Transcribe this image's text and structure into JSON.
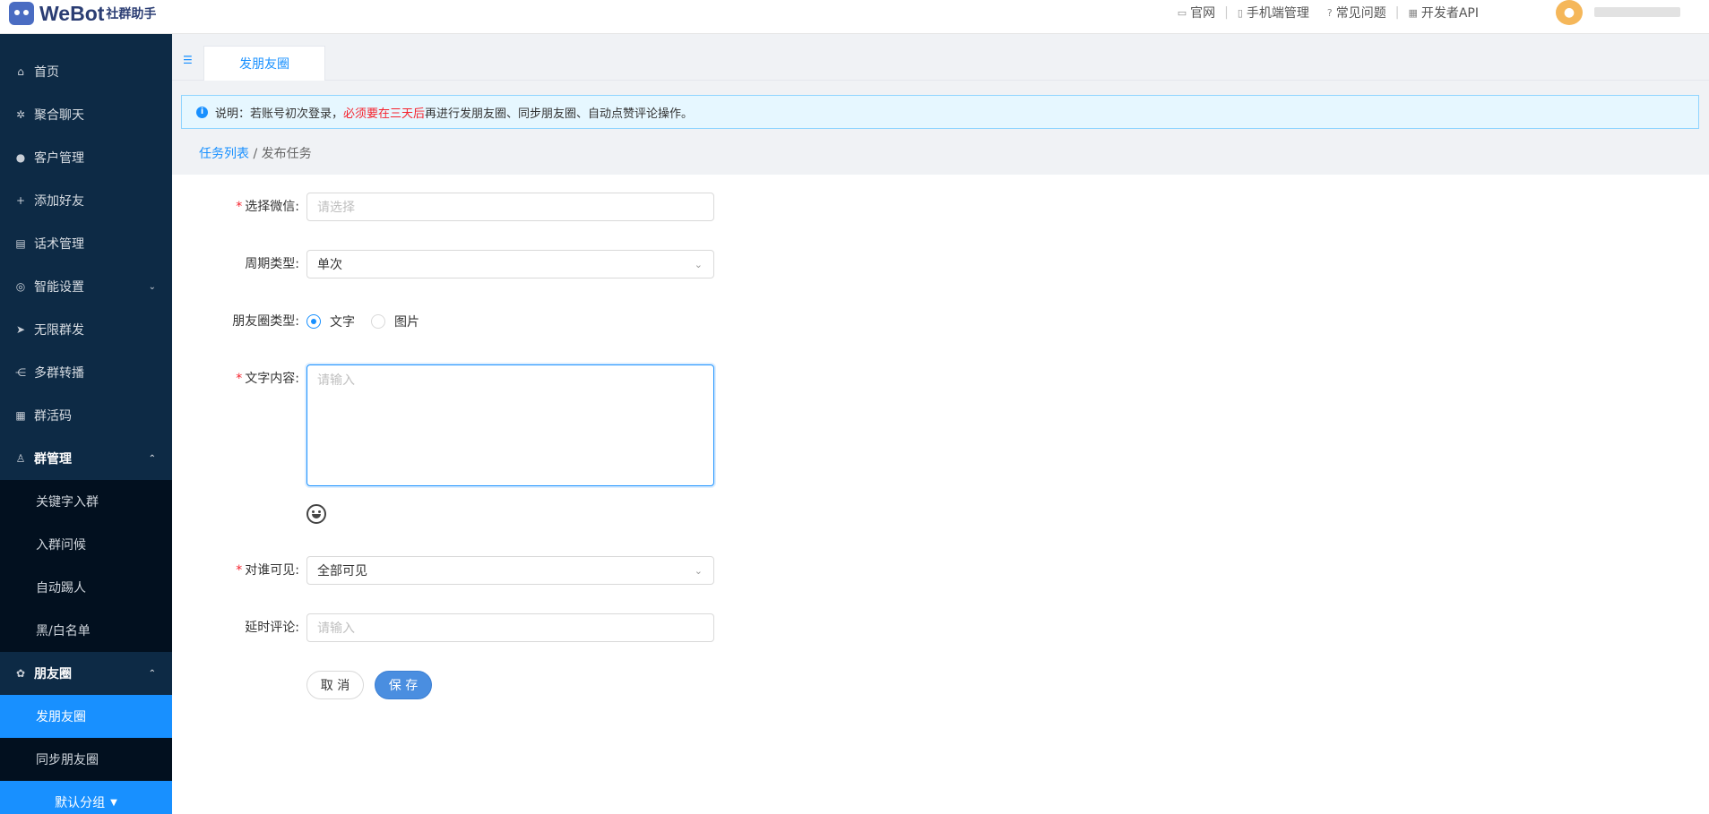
{
  "brand": {
    "name": "WeBot",
    "subtitle": "社群助手"
  },
  "top_nav": [
    {
      "icon": "monitor-icon",
      "label": "官网"
    },
    {
      "icon": "phone-icon",
      "label": "手机端管理"
    },
    {
      "icon": "question-icon",
      "label": "常见问题"
    },
    {
      "icon": "api-icon",
      "label": "开发者API"
    }
  ],
  "sidebar": {
    "items": [
      {
        "icon": "home-icon",
        "label": "首页"
      },
      {
        "icon": "gear-icon",
        "label": "聚合聊天"
      },
      {
        "icon": "user-icon",
        "label": "客户管理"
      },
      {
        "icon": "add-user-icon",
        "label": "添加好友"
      },
      {
        "icon": "document-icon",
        "label": "话术管理"
      },
      {
        "icon": "smart-settings-icon",
        "label": "智能设置"
      },
      {
        "icon": "send-icon",
        "label": "无限群发"
      },
      {
        "icon": "relay-icon",
        "label": "多群转播"
      },
      {
        "icon": "qrcode-icon",
        "label": "群活码"
      },
      {
        "icon": "group-icon",
        "label": "群管理"
      }
    ],
    "group_sub": [
      "关键字入群",
      "入群问候",
      "自动踢人",
      "黑/白名单"
    ],
    "moments": {
      "icon": "moments-icon",
      "label": "朋友圈"
    },
    "moments_sub": [
      "发朋友圈",
      "同步朋友圈"
    ],
    "default_group": "默认分组"
  },
  "tab": {
    "label": "发朋友圈"
  },
  "notice": {
    "prefix": "说明：若账号初次登录，",
    "highlight": "必须要在三天后",
    "suffix": "再进行发朋友圈、同步朋友圈、自动点赞评论操作。"
  },
  "breadcrumb": {
    "parent": "任务列表",
    "separator": " / ",
    "current": "发布任务"
  },
  "form": {
    "wechat_label": "选择微信:",
    "wechat_placeholder": "请选择",
    "cycle_label": "周期类型:",
    "cycle_value": "单次",
    "type_label": "朋友圈类型:",
    "type_options": [
      "文字",
      "图片"
    ],
    "content_label": "文字内容:",
    "content_placeholder": "请输入",
    "visible_label": "对谁可见:",
    "visible_value": "全部可见",
    "delay_label": "延时评论:",
    "delay_placeholder": "请输入",
    "cancel_label": "取 消",
    "save_label": "保 存"
  },
  "colors": {
    "sidebar": "#0d2a45",
    "active": "#1890ff",
    "required": "#f5222d"
  }
}
